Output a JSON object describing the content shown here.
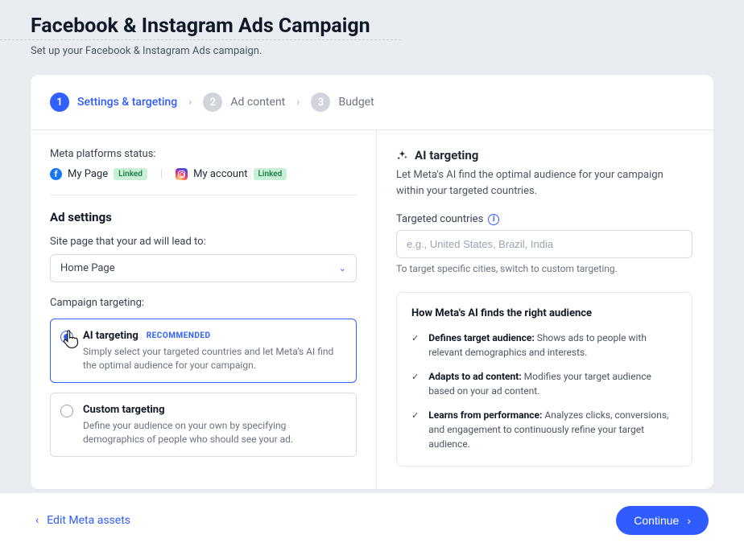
{
  "header": {
    "title": "Facebook & Instagram Ads Campaign",
    "subtitle": "Set up your Facebook & Instagram Ads campaign."
  },
  "stepper": {
    "steps": [
      {
        "num": "1",
        "label": "Settings & targeting"
      },
      {
        "num": "2",
        "label": "Ad content"
      },
      {
        "num": "3",
        "label": "Budget"
      }
    ]
  },
  "platforms": {
    "label": "Meta platforms status:",
    "facebook": {
      "name": "My Page",
      "badge": "Linked"
    },
    "instagram": {
      "name": "My account",
      "badge": "Linked"
    }
  },
  "ad_settings": {
    "heading": "Ad settings",
    "site_page_label": "Site page that your ad will lead to:",
    "site_page_value": "Home Page",
    "campaign_targeting_label": "Campaign targeting:",
    "options": {
      "ai": {
        "title": "AI targeting",
        "recommended": "RECOMMENDED",
        "desc": "Simply select your targeted countries and let Meta's AI find the optimal audience for your campaign."
      },
      "custom": {
        "title": "Custom targeting",
        "desc": "Define your audience on your own by specifying demographics of people who should see your ad."
      }
    }
  },
  "ai_panel": {
    "heading": "AI targeting",
    "subtext": "Let Meta's AI find the optimal audience for your campaign within your targeted countries.",
    "countries_label": "Targeted countries",
    "countries_placeholder": "e.g., United States, Brazil, India",
    "countries_hint": "To target specific cities, switch to custom targeting.",
    "info_box": {
      "title": "How Meta's AI finds the right audience",
      "items": [
        {
          "bold": "Defines target audience:",
          "rest": " Shows ads to people with relevant demographics and interests."
        },
        {
          "bold": "Adapts to ad content:",
          "rest": " Modifies your target audience based on your ad content."
        },
        {
          "bold": "Learns from performance:",
          "rest": " Analyzes clicks, conversions, and engagement to continuously refine your target audience."
        }
      ]
    }
  },
  "footer": {
    "back": "Edit Meta assets",
    "continue": "Continue"
  }
}
